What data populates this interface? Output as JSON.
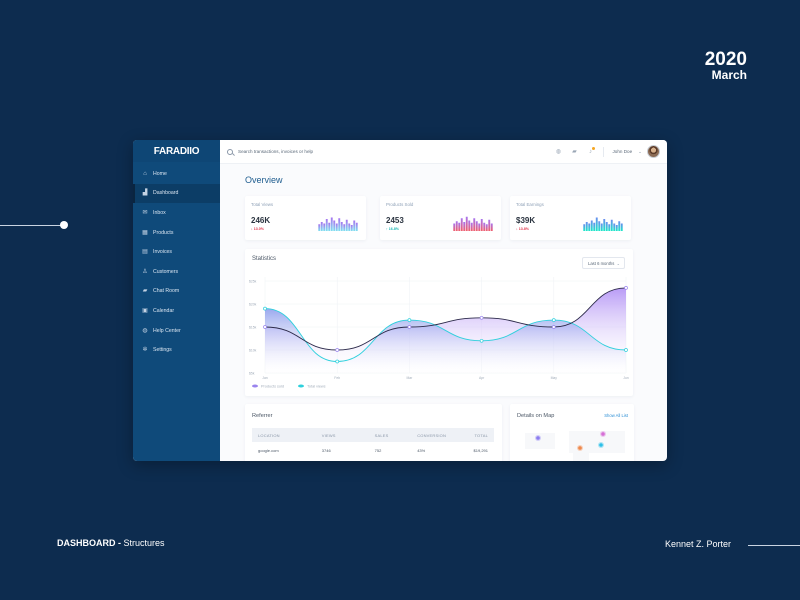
{
  "showcase": {
    "year": "2020",
    "month": "March",
    "footer_title": "DASHBOARD",
    "footer_sep": " - ",
    "footer_subtitle": "Structures",
    "author": "Kennet Z. Porter"
  },
  "app": {
    "logo": "FARADIIO",
    "sidebar": {
      "items": [
        {
          "label": "Home",
          "icon": "home-icon",
          "glyph": "⌂",
          "active": false
        },
        {
          "label": "Dashboard",
          "icon": "bar-chart-icon",
          "glyph": "▟",
          "active": true
        },
        {
          "label": "Inbox",
          "icon": "inbox-icon",
          "glyph": "✉",
          "active": false
        },
        {
          "label": "Products",
          "icon": "products-icon",
          "glyph": "▦",
          "active": false
        },
        {
          "label": "Invoices",
          "icon": "invoice-icon",
          "glyph": "▤",
          "active": false
        },
        {
          "label": "Customers",
          "icon": "user-icon",
          "glyph": "♙",
          "active": false
        },
        {
          "label": "Chat Room",
          "icon": "chat-icon",
          "glyph": "▰",
          "active": false
        },
        {
          "label": "Calendar",
          "icon": "calendar-icon",
          "glyph": "▣",
          "active": false
        },
        {
          "label": "Help Center",
          "icon": "globe-icon",
          "glyph": "◍",
          "active": false
        },
        {
          "label": "Settings",
          "icon": "gear-icon",
          "glyph": "✲",
          "active": false
        }
      ]
    },
    "topbar": {
      "search_placeholder": "Search transactions, invoices or help",
      "user_name": "John Doe",
      "icons": [
        "globe-icon",
        "chat-icon",
        "bell-icon"
      ]
    },
    "page_title": "Overview",
    "kpis": [
      {
        "label": "Total Views",
        "value": "246K",
        "delta": "13.0%",
        "trend": "down",
        "delta_color": "#e0364c",
        "bar_color_top": "#a774f0",
        "bar_color_bottom": "#7fe0f0",
        "bars": [
          0.45,
          0.6,
          0.5,
          0.8,
          0.55,
          0.9,
          0.7,
          0.5,
          0.85,
          0.6,
          0.45,
          0.75,
          0.5,
          0.4,
          0.7,
          0.55
        ]
      },
      {
        "label": "Products Sold",
        "value": "2453",
        "delta": "16.8%",
        "trend": "up",
        "delta_color": "#16b6b2",
        "bar_color_top": "#a774f0",
        "bar_color_bottom": "#f0606e",
        "bars": [
          0.5,
          0.65,
          0.55,
          0.85,
          0.6,
          0.95,
          0.7,
          0.55,
          0.85,
          0.65,
          0.5,
          0.8,
          0.55,
          0.45,
          0.75,
          0.5
        ]
      },
      {
        "label": "Total Earnings",
        "value": "$39K",
        "delta": "13.8%",
        "trend": "down",
        "delta_color": "#e0364c",
        "bar_color_top": "#6a8cf0",
        "bar_color_bottom": "#1de8c8",
        "bars": [
          0.45,
          0.6,
          0.5,
          0.7,
          0.55,
          0.9,
          0.65,
          0.5,
          0.8,
          0.6,
          0.45,
          0.75,
          0.5,
          0.4,
          0.65,
          0.5
        ]
      }
    ],
    "statistics": {
      "title": "Statistics",
      "range": "Last 6 months"
    },
    "referrer": {
      "title": "Referrer",
      "columns": [
        "LOCATION",
        "VIEWS",
        "SALES",
        "CONVERSION",
        "TOTAL"
      ],
      "rows": [
        [
          "google.com",
          "3746",
          "752",
          "43%",
          "$19,291"
        ]
      ]
    },
    "map": {
      "title": "Details on Map",
      "link": "Show All List",
      "pins": [
        {
          "name": "north-america",
          "color": "#8b7cf0"
        },
        {
          "name": "asia",
          "color": "#d66fd6"
        },
        {
          "name": "south-asia",
          "color": "#f0884a"
        },
        {
          "name": "east-asia",
          "color": "#2dbfe8"
        }
      ]
    }
  },
  "chart_data": {
    "type": "area",
    "title": "Statistics",
    "categories": [
      "Jan",
      "Feb",
      "Mar",
      "Apr",
      "May",
      "Jun"
    ],
    "ylabel": "",
    "yticks": [
      "$5k",
      "$10k",
      "$15k",
      "$20k",
      "$25k"
    ],
    "ylim": [
      5,
      25
    ],
    "grid": true,
    "legend_position": "bottom-left",
    "series": [
      {
        "name": "Products sold",
        "color": "#9a84ee",
        "values": [
          15,
          10,
          15,
          17,
          15,
          23.5
        ]
      },
      {
        "name": "Total views",
        "color": "#2ed0dc",
        "values": [
          19,
          7.5,
          16.5,
          12,
          16.5,
          10
        ]
      }
    ]
  }
}
